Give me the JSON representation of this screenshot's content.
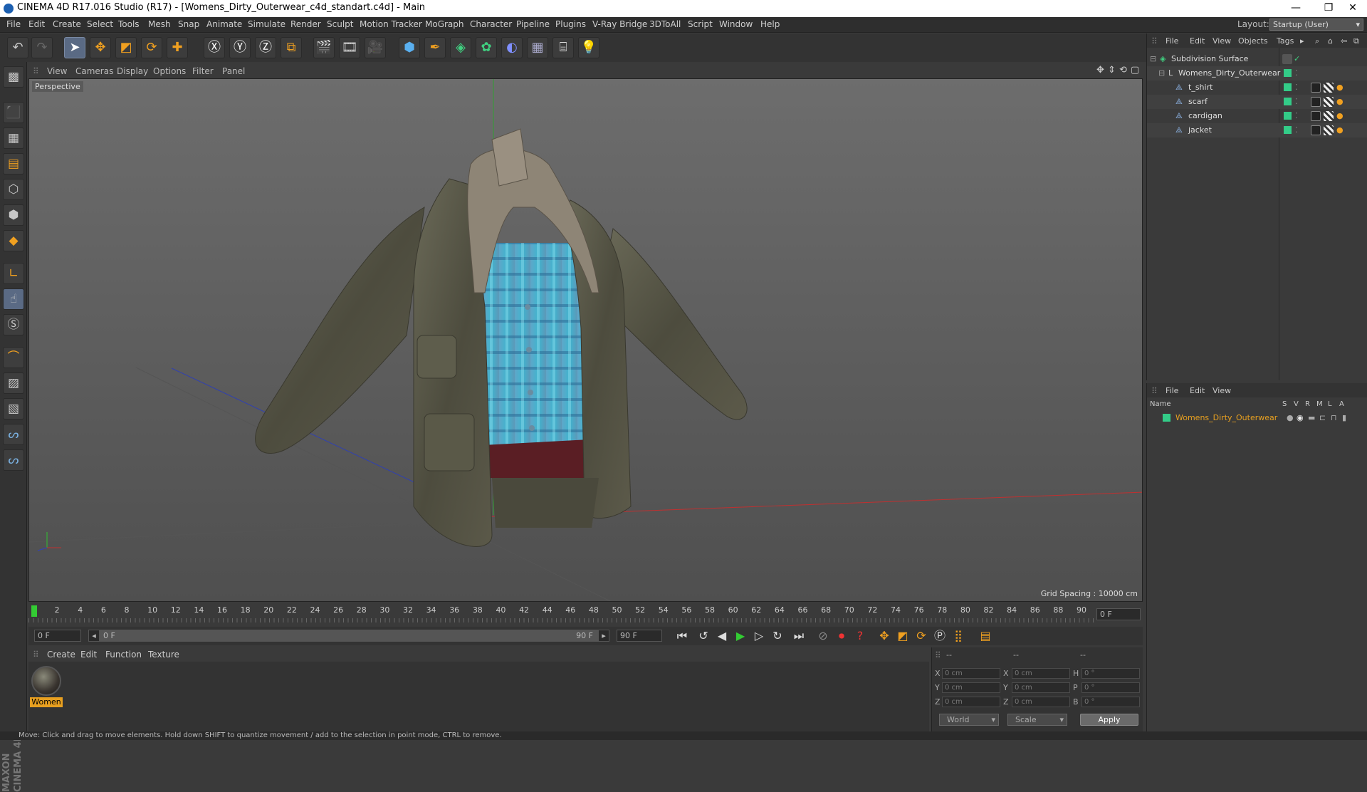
{
  "window": {
    "title": "CINEMA 4D R17.016 Studio (R17) - [Womens_Dirty_Outerwear_c4d_standart.c4d] - Main",
    "minimize": "—",
    "maximize": "❐",
    "close": "✕"
  },
  "menu": [
    "File",
    "Edit",
    "Create",
    "Select",
    "Tools",
    "Mesh",
    "Snap",
    "Animate",
    "Simulate",
    "Render",
    "Sculpt",
    "Motion Tracker",
    "MoGraph",
    "Character",
    "Pipeline",
    "Plugins",
    "V-Ray Bridge",
    "3DToAll",
    "Script",
    "Window",
    "Help"
  ],
  "layout": {
    "label": "Layout:",
    "value": "Startup (User)"
  },
  "viewport": {
    "menu": [
      "View",
      "Cameras",
      "Display",
      "Options",
      "Filter",
      "Panel"
    ],
    "camera": "Perspective",
    "grid_spacing": "Grid Spacing : 10000 cm"
  },
  "timeline": {
    "ticks": [
      "0",
      "2",
      "4",
      "6",
      "8",
      "10",
      "12",
      "14",
      "16",
      "18",
      "20",
      "22",
      "24",
      "26",
      "28",
      "30",
      "32",
      "34",
      "36",
      "38",
      "40",
      "42",
      "44",
      "46",
      "48",
      "50",
      "52",
      "54",
      "56",
      "58",
      "60",
      "62",
      "64",
      "66",
      "68",
      "70",
      "72",
      "74",
      "76",
      "78",
      "80",
      "82",
      "84",
      "86",
      "88",
      "90"
    ],
    "current_frame": "0 F",
    "start_field": "0 F",
    "range_start": "0 F",
    "range_end": "90 F",
    "end_field": "90 F"
  },
  "materials": {
    "menu": [
      "Create",
      "Edit",
      "Function",
      "Texture"
    ],
    "items": [
      {
        "label": "Women"
      }
    ]
  },
  "coords": {
    "header": [
      "--",
      "--",
      "--"
    ],
    "rows": [
      {
        "a": "X",
        "av": "0 cm",
        "b": "X",
        "bv": "0 cm",
        "c": "H",
        "cv": "0 °"
      },
      {
        "a": "Y",
        "av": "0 cm",
        "b": "Y",
        "bv": "0 cm",
        "c": "P",
        "cv": "0 °"
      },
      {
        "a": "Z",
        "av": "0 cm",
        "b": "Z",
        "bv": "0 cm",
        "c": "B",
        "cv": "0 °"
      }
    ],
    "world": "World",
    "scale": "Scale",
    "apply": "Apply"
  },
  "objects": {
    "menu": [
      "File",
      "Edit",
      "View",
      "Objects",
      "Tags"
    ],
    "tree": [
      {
        "name": "Subdivision Surface"
      },
      {
        "name": "Womens_Dirty_Outerwear"
      },
      {
        "name": "t_shirt"
      },
      {
        "name": "scarf"
      },
      {
        "name": "cardigan"
      },
      {
        "name": "jacket"
      }
    ]
  },
  "attributes": {
    "menu": [
      "File",
      "Edit",
      "View"
    ],
    "columns": [
      "Name",
      "S",
      "V",
      "R",
      "M",
      "L",
      "A"
    ],
    "layer": "Womens_Dirty_Outerwear"
  },
  "status": "Move: Click and drag to move elements. Hold down SHIFT to quantize movement / add to the selection in point mode, CTRL to remove.",
  "colors": {
    "accent": "#e8a020",
    "layer_green": "#33cc88",
    "axis_x": "#c03030",
    "axis_y": "#30a030",
    "axis_z": "#3040b0"
  }
}
